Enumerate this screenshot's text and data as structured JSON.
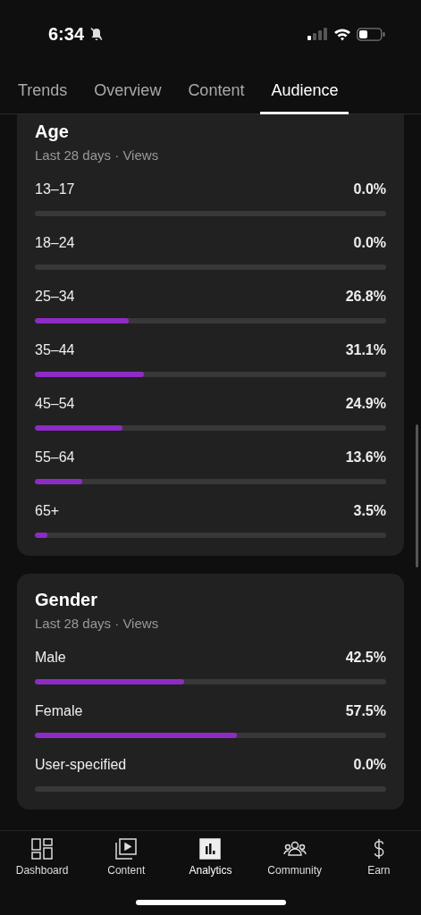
{
  "status_bar": {
    "time": "6:34",
    "silent": true
  },
  "tabs": [
    {
      "label": "Trends",
      "selected": false
    },
    {
      "label": "Overview",
      "selected": false
    },
    {
      "label": "Content",
      "selected": false
    },
    {
      "label": "Audience",
      "selected": true
    }
  ],
  "cards": [
    {
      "title": "Age",
      "subtitle": "Last 28 days · Views",
      "rows": [
        {
          "label": "13–17",
          "value": "0.0%"
        },
        {
          "label": "18–24",
          "value": "0.0%"
        },
        {
          "label": "25–34",
          "value": "26.8%",
          "level": 0.268
        },
        {
          "label": "35–44",
          "value": "31.1%",
          "level": 0.311
        },
        {
          "label": "45–54",
          "value": "24.9%",
          "level": 0.249
        },
        {
          "label": "55–64",
          "value": "13.6%",
          "level": 0.136
        },
        {
          "label": "65+",
          "value": "3.5%",
          "level": 0.035
        }
      ]
    },
    {
      "title": "Gender",
      "subtitle": "Last 28 days · Views",
      "rows": [
        {
          "label": "Male",
          "value": "42.5%",
          "level": 0.425
        },
        {
          "label": "Female",
          "value": "57.5%",
          "level": 0.575
        },
        {
          "label": "User-specified",
          "value": "0.0%"
        }
      ]
    }
  ],
  "nav": [
    {
      "label": "Dashboard",
      "kind": "dashboard",
      "selected": false
    },
    {
      "label": "Content",
      "kind": "content",
      "selected": false
    },
    {
      "label": "Analytics",
      "kind": "analytics",
      "selected": true
    },
    {
      "label": "Community",
      "kind": "community",
      "selected": false
    },
    {
      "label": "Earn",
      "kind": "earn",
      "selected": false
    }
  ]
}
